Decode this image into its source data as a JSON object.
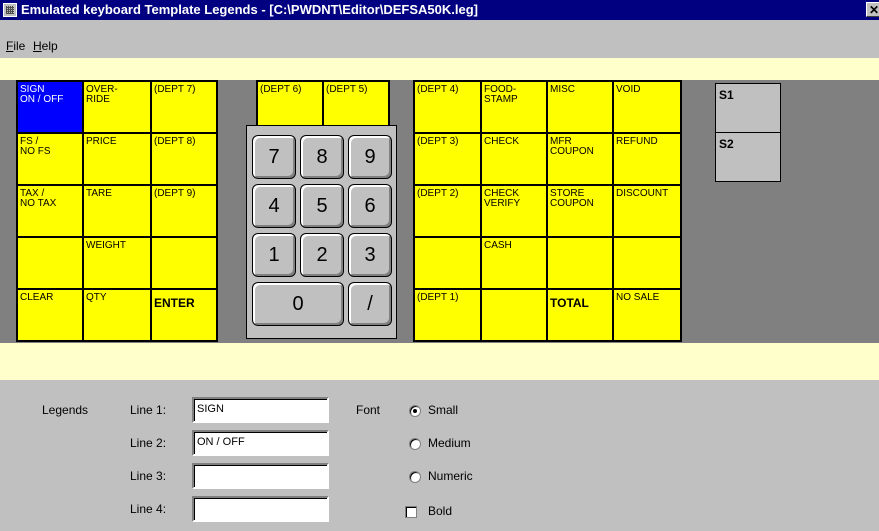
{
  "window": {
    "title": "Emulated keyboard Template Legends - [C:\\PWDNT\\Editor\\DEFSA50K.leg]",
    "close_glyph": "✕"
  },
  "menu": [
    {
      "label": "File",
      "mnemonic": "F"
    },
    {
      "label": "Help",
      "mnemonic": "H"
    }
  ],
  "colors": {
    "key": "#ffff00",
    "selected_key": "#0000ff",
    "panel": "#808080",
    "stripe": "#ffffcc"
  },
  "keys_left": [
    [
      "SIGN\nON / OFF",
      "OVER-\nRIDE",
      "(DEPT 7)"
    ],
    [
      "FS /\nNO FS",
      "PRICE",
      "(DEPT 8)"
    ],
    [
      "TAX /\nNO TAX",
      "TARE",
      "(DEPT 9)"
    ],
    [
      "",
      "WEIGHT",
      ""
    ],
    [
      "CLEAR",
      "QTY",
      "ENTER"
    ]
  ],
  "keys_top": [
    "(DEPT 6)",
    "(DEPT 5)"
  ],
  "numpad": [
    "7",
    "8",
    "9",
    "4",
    "5",
    "6",
    "1",
    "2",
    "3",
    "0",
    "/"
  ],
  "keys_right": [
    [
      "(DEPT 4)",
      "FOOD-\nSTAMP",
      "MISC",
      "VOID"
    ],
    [
      "(DEPT 3)",
      "CHECK",
      "MFR\nCOUPON",
      "REFUND"
    ],
    [
      "(DEPT 2)",
      "CHECK\nVERIFY",
      "STORE\nCOUPON",
      "DISCOUNT"
    ],
    [
      "",
      "CASH",
      "",
      ""
    ],
    [
      "(DEPT 1)",
      "",
      "TOTAL",
      "NO SALE"
    ]
  ],
  "special_keys": [
    "S1",
    "S2"
  ],
  "form": {
    "legends_label": "Legends",
    "lines": [
      {
        "label": "Line 1:",
        "value": "SIGN"
      },
      {
        "label": "Line 2:",
        "value": "ON / OFF"
      },
      {
        "label": "Line 3:",
        "value": ""
      },
      {
        "label": "Line 4:",
        "value": ""
      }
    ],
    "font_label": "Font",
    "font_options": [
      {
        "label": "Small",
        "selected": true
      },
      {
        "label": "Medium",
        "selected": false
      },
      {
        "label": "Numeric",
        "selected": false
      }
    ],
    "bold": {
      "label": "Bold",
      "checked": false
    }
  }
}
